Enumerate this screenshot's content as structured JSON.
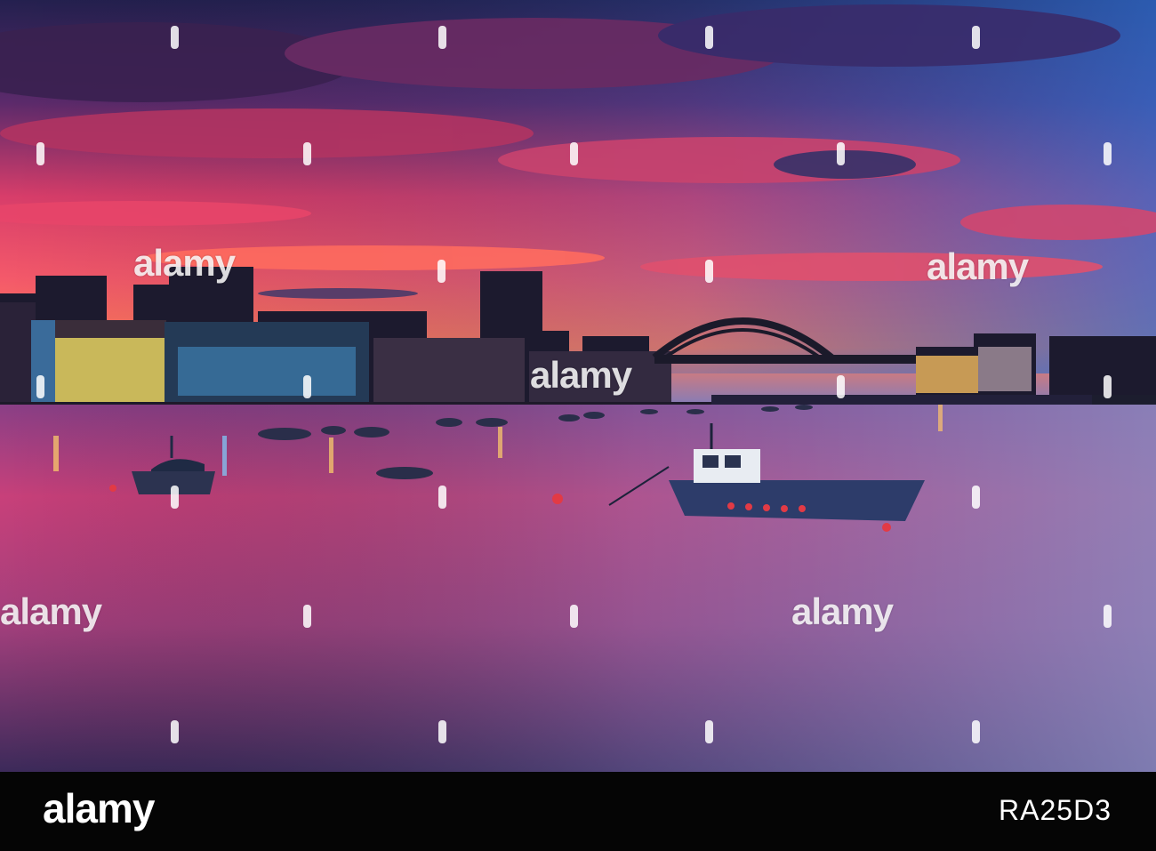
{
  "watermark": {
    "text": "alamy",
    "color": "#ffffff"
  },
  "footer": {
    "logo_text": "alamy",
    "image_id": "RA25D3",
    "background": "#050505"
  },
  "scene": {
    "sky_colors": [
      "#2b1b4d",
      "#7a2c6b",
      "#e0436a",
      "#ff6a4a",
      "#3f6fc4"
    ],
    "water_colors": [
      "#3a1f52",
      "#c2407a",
      "#6b5aa0"
    ]
  }
}
